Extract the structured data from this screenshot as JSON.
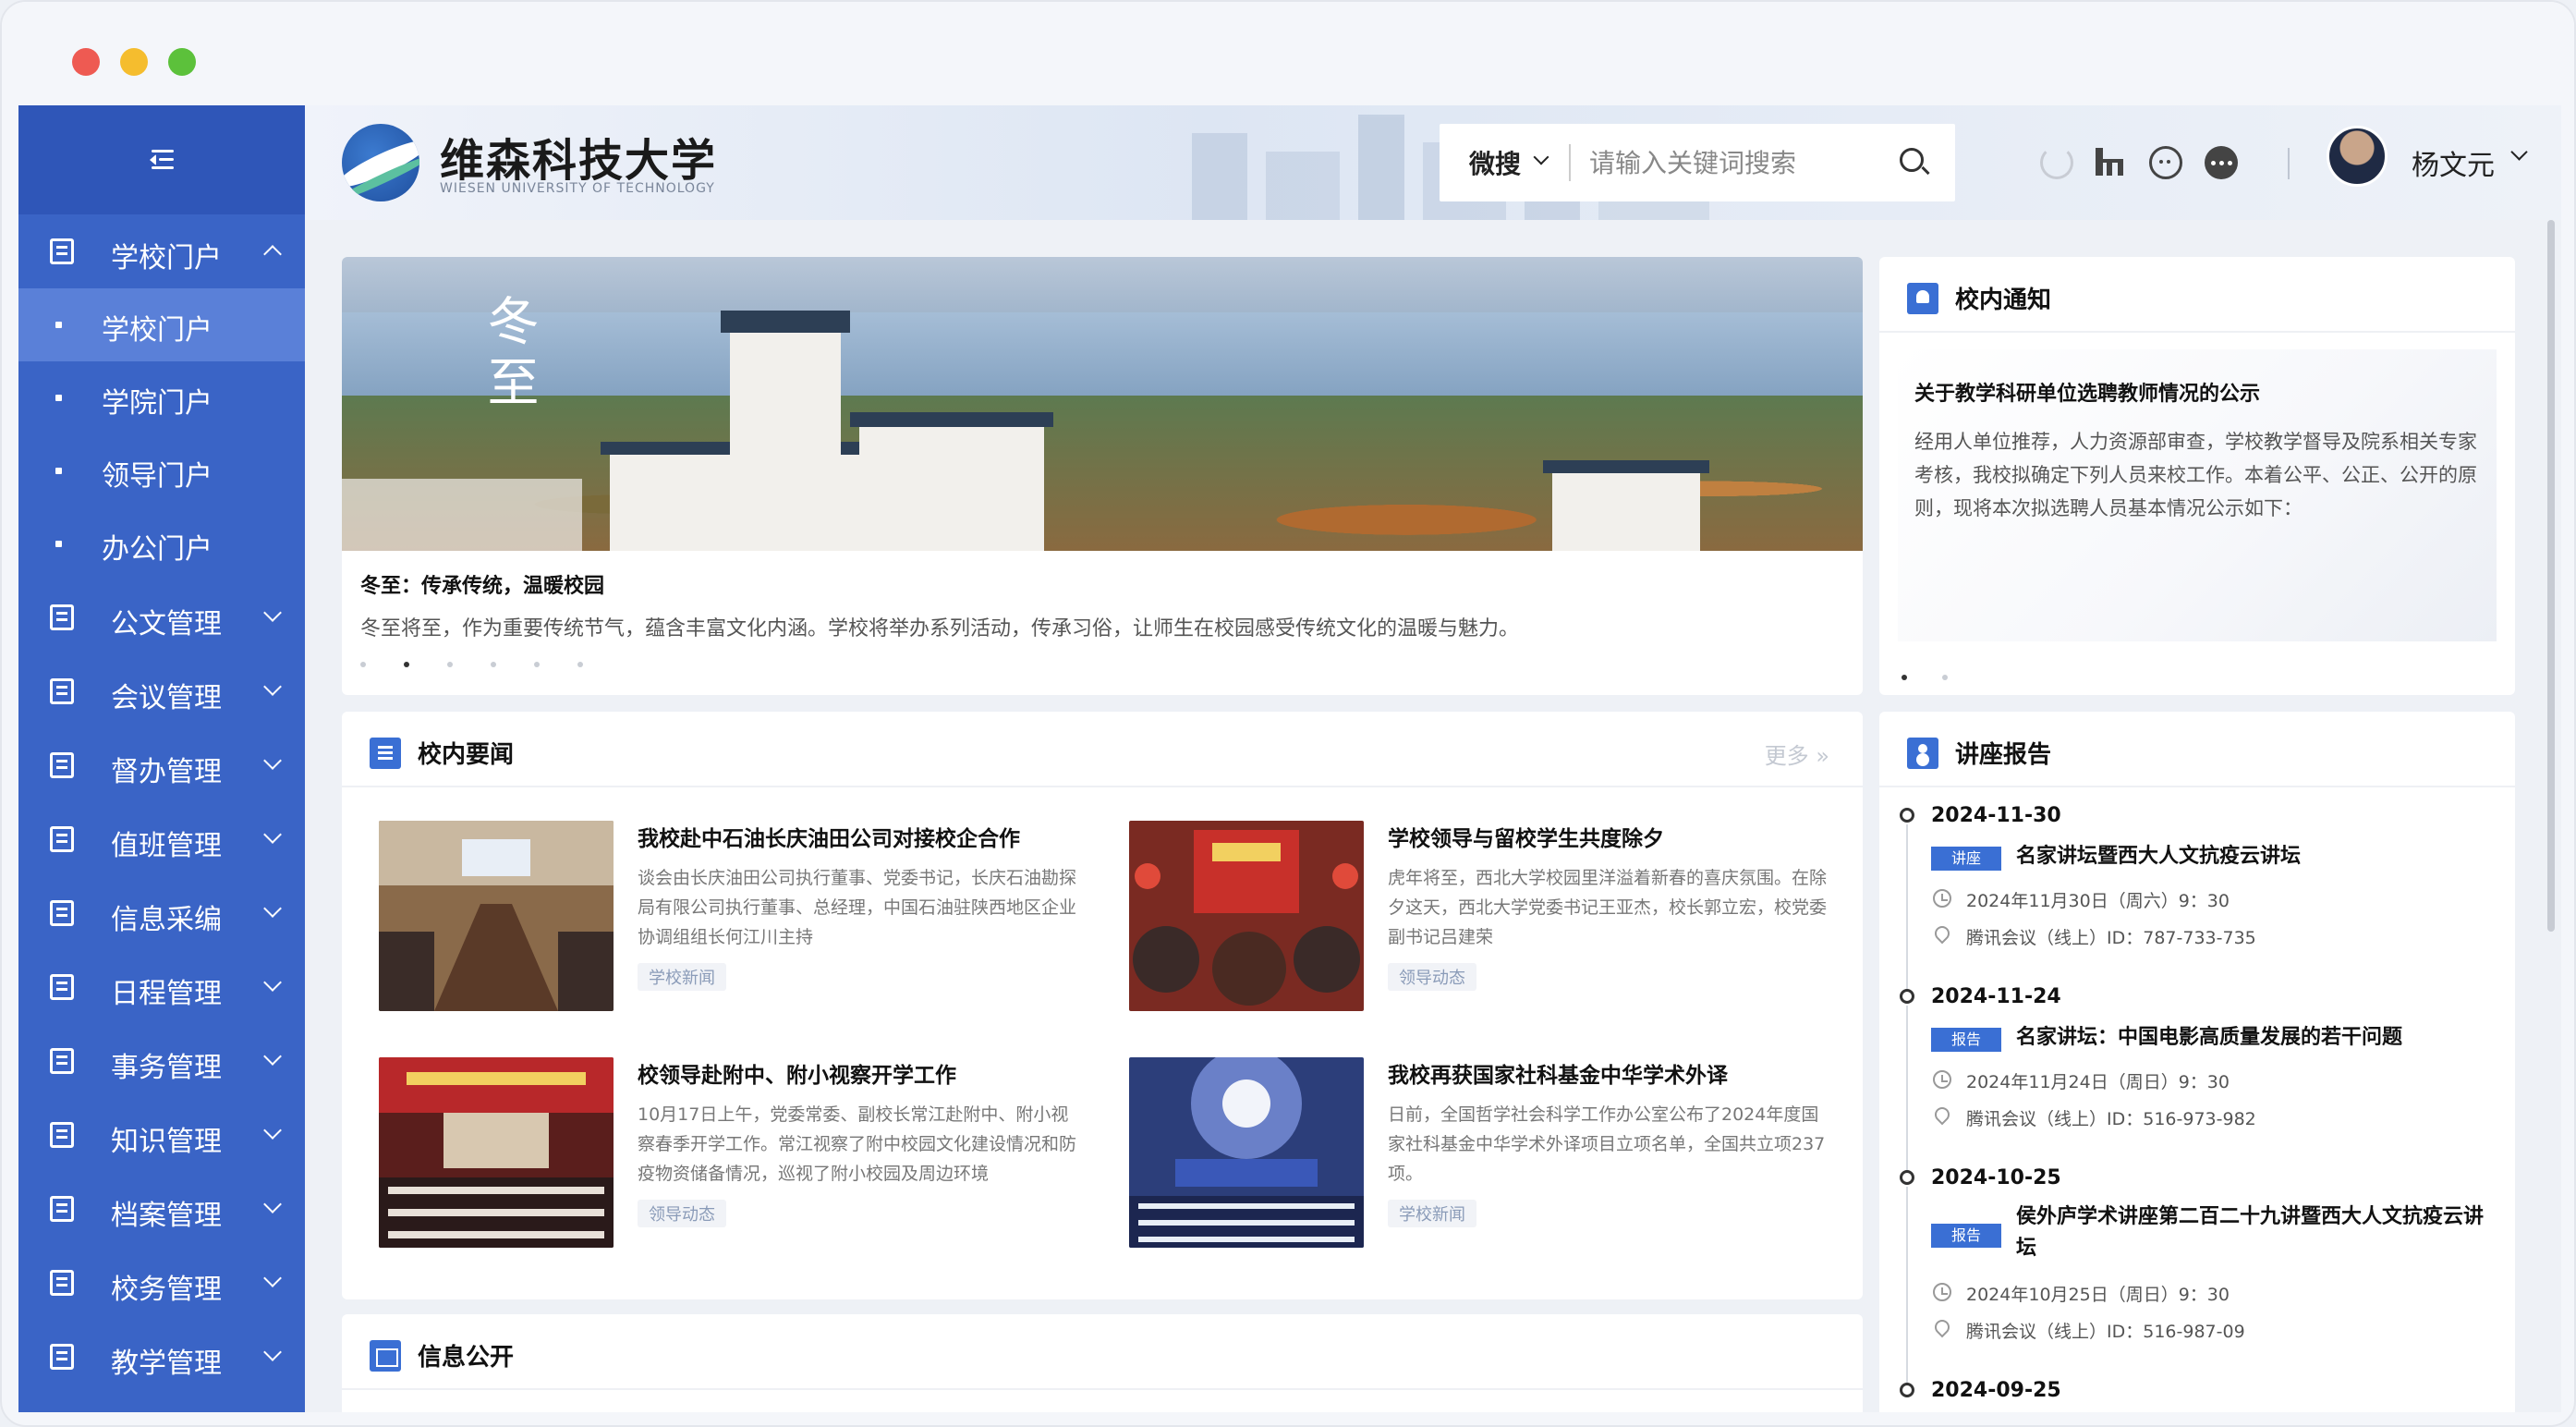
{
  "app": {
    "name": "维森科技大学",
    "name_en": "WIESEN UNIVERSITY OF TECHNOLOGY"
  },
  "colors": {
    "sidebar": "#3a64c6",
    "sidebar_active": "#5a80d8",
    "accent": "#3a6fd4"
  },
  "sidebar": {
    "collapse_icon": "menu-collapse-icon",
    "groups": [
      {
        "label": "学校门户",
        "icon": "document-icon",
        "expanded": true,
        "children": [
          "学校门户",
          "学院门户",
          "领导门户",
          "办公门户"
        ],
        "active_child": "学校门户"
      },
      {
        "label": "公文管理",
        "icon": "document-icon"
      },
      {
        "label": "会议管理",
        "icon": "document-icon"
      },
      {
        "label": "督办管理",
        "icon": "document-icon"
      },
      {
        "label": "值班管理",
        "icon": "document-icon"
      },
      {
        "label": "信息采编",
        "icon": "bank-icon"
      },
      {
        "label": "日程管理",
        "icon": "calendar-icon"
      },
      {
        "label": "事务管理",
        "icon": "document-icon"
      },
      {
        "label": "知识管理",
        "icon": "document-icon"
      },
      {
        "label": "档案管理",
        "icon": "document-icon"
      },
      {
        "label": "校务管理",
        "icon": "document-icon"
      },
      {
        "label": "教学管理",
        "icon": "document-icon"
      }
    ]
  },
  "header": {
    "search_scope": "微搜",
    "search_placeholder": "请输入关键词搜索",
    "user_name": "杨文元",
    "icons": [
      "refresh-icon",
      "org-chart-icon",
      "chat-icon",
      "more-icon"
    ]
  },
  "banner": {
    "calligraphy": "冬至",
    "title": "冬至：传承传统，温暖校园",
    "desc": "冬至将至，作为重要传统节气，蕴含丰富文化内涵。学校将举办系列活动，传承习俗，让师生在校园感受传统文化的温暖与魅力。",
    "slides": 6,
    "active_slide": 2
  },
  "notice": {
    "title": "校内通知",
    "item_title": "关于教学科研单位选聘教师情况的公示",
    "item_text": "经用人单位推荐，人力资源部审查，学校教学督导及院系相关专家考核，我校拟确定下列人员来校工作。本着公平、公正、公开的原则，现将本次拟选聘人员基本情况公示如下：",
    "slides": 2,
    "active_slide": 1
  },
  "news": {
    "title": "校内要闻",
    "more": "更多 »",
    "items": [
      {
        "title": "我校赴中石油长庆油田公司对接校企合作",
        "summary": "谈会由长庆油田公司执行董事、党委书记，长庆石油勘探局有限公司执行董事、总经理，中国石油驻陕西地区企业协调组组长何江川主持",
        "tag": "学校新闻"
      },
      {
        "title": "学校领导与留校学生共度除夕",
        "summary": "虎年将至，西北大学校园里洋溢着新春的喜庆氛围。在除夕这天，西北大学党委书记王亚杰，校长郭立宏，校党委副书记吕建荣",
        "tag": "领导动态"
      },
      {
        "title": "校领导赴附中、附小视察开学工作",
        "summary": "10月17日上午，党委常委、副校长常江赴附中、附小视察春季开学工作。常江视察了附中校园文化建设情况和防疫物资储备情况，巡视了附小校园及周边环境",
        "tag": "领导动态"
      },
      {
        "title": "我校再获国家社科基金中华学术外译",
        "summary": "日前，全国哲学社会科学工作办公室公布了2024年度国家社科基金中华学术外译项目立项名单，全国共立项237项。",
        "tag": "学校新闻"
      }
    ]
  },
  "lectures": {
    "title": "讲座报告",
    "items": [
      {
        "date": "2024-11-30",
        "badge": "讲座",
        "title": "名家讲坛暨西大人文抗疫云讲坛",
        "time": "2024年11月30日（周六）9：30",
        "location": "腾讯会议（线上）ID：787-733-735"
      },
      {
        "date": "2024-11-24",
        "badge": "报告",
        "title": "名家讲坛：中国电影高质量发展的若干问题",
        "time": "2024年11月24日（周日）9：30",
        "location": "腾讯会议（线上）ID：516-973-982"
      },
      {
        "date": "2024-10-25",
        "badge": "报告",
        "title": "侯外庐学术讲座第二百二十九讲暨西大人文抗疫云讲坛",
        "time": "2024年10月25日（周日）9：30",
        "location": "腾讯会议（线上）ID：516-987-09"
      },
      {
        "date": "2024-09-25"
      }
    ]
  },
  "info": {
    "title": "信息公开"
  }
}
